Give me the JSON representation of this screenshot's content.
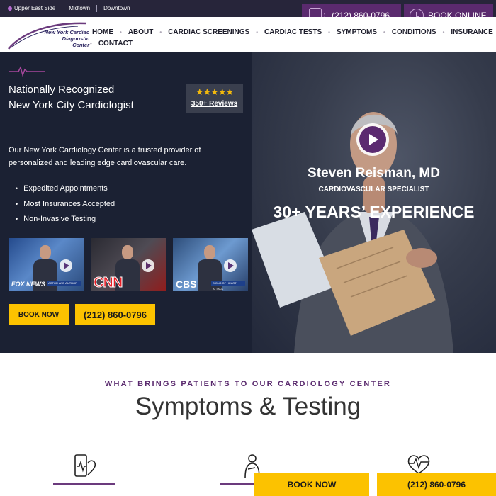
{
  "topbar": {
    "locations": [
      "Upper East Side",
      "Midtown",
      "Downtown"
    ],
    "phone_label": "(212) 860-0796",
    "book_label": "BOOK ONLINE",
    "icons": {
      "location": "map-pin-icon",
      "phone": "phone-icon",
      "book": "clock-icon"
    }
  },
  "logo": {
    "line1": "New York Cardiac",
    "line2": "Diagnostic Center"
  },
  "nav": {
    "items": [
      "HOME",
      "ABOUT",
      "CARDIAC SCREENINGS",
      "CARDIAC TESTS",
      "SYMPTOMS",
      "CONDITIONS",
      "INSURANCE",
      "CONTACT"
    ]
  },
  "hero": {
    "title_line1": "Nationally Recognized",
    "title_line2": "New York City Cardiologist",
    "rating": {
      "stars": "★★★★★",
      "reviews": "350+ Reviews",
      "value": 5
    },
    "intro": "Our New York Cardiology Center is a trusted provider of personalized and leading edge cardiovascular care.",
    "bullets": [
      "Expedited Appointments",
      "Most Insurances Accepted",
      "Non-Invasive Testing"
    ],
    "videos": [
      {
        "network": "FOX NEWS",
        "ticker": "ACTOR AND AUTHOR"
      },
      {
        "network": "CNN",
        "ticker": ""
      },
      {
        "network": "CBS",
        "ticker": "SIGNS OF HEART ATTACK"
      }
    ],
    "book_label": "BOOK NOW",
    "phone_label": "(212) 860-0796",
    "doctor": {
      "name": "Steven Reisman, MD",
      "role": "CARDIOVASCULAR SPECIALIST",
      "experience": "30+ YEARS’ EXPERIENCE"
    }
  },
  "section": {
    "kicker": "WHAT BRINGS PATIENTS TO OUR CARDIOLOGY CENTER",
    "title": "Symptoms & Testing"
  },
  "sticky": {
    "book_label": "BOOK NOW",
    "phone_label": "(212) 860-0796"
  },
  "colors": {
    "brand_purple": "#5a2a6e",
    "accent_yellow": "#fcc200",
    "hero_bg": "#1b2133",
    "topbar_bg": "#27253a"
  }
}
